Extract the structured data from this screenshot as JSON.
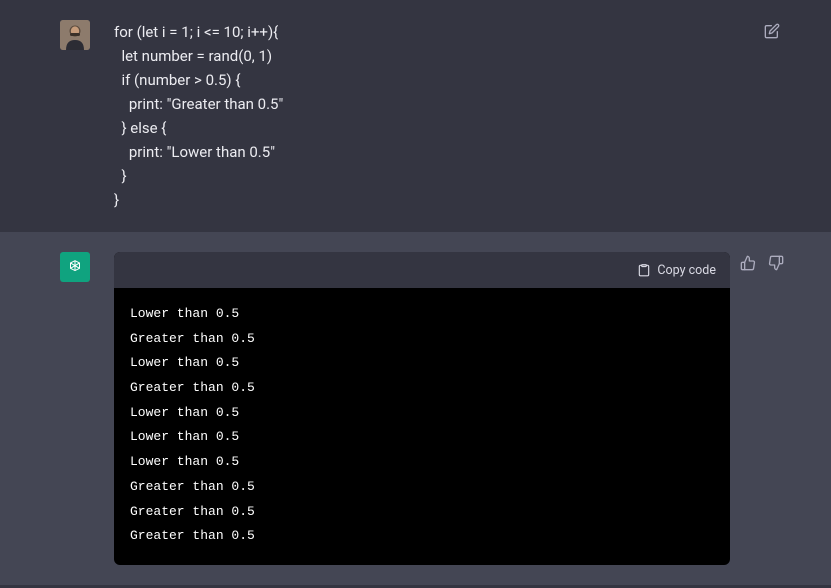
{
  "user_message": {
    "code_lines": [
      "for (let i = 1; i <= 10; i++){",
      "  let number = rand(0, 1)",
      "  if (number > 0.5) {",
      "    print: \"Greater than 0.5\"",
      "  } else {",
      "    print: \"Lower than 0.5\"",
      "  }",
      "}"
    ]
  },
  "assistant_message": {
    "copy_label": "Copy code",
    "output_lines": [
      "Lower than 0.5",
      "Greater than 0.5",
      "Lower than 0.5",
      "Greater than 0.5",
      "Lower than 0.5",
      "Lower than 0.5",
      "Lower than 0.5",
      "Greater than 0.5",
      "Greater than 0.5",
      "Greater than 0.5"
    ]
  }
}
